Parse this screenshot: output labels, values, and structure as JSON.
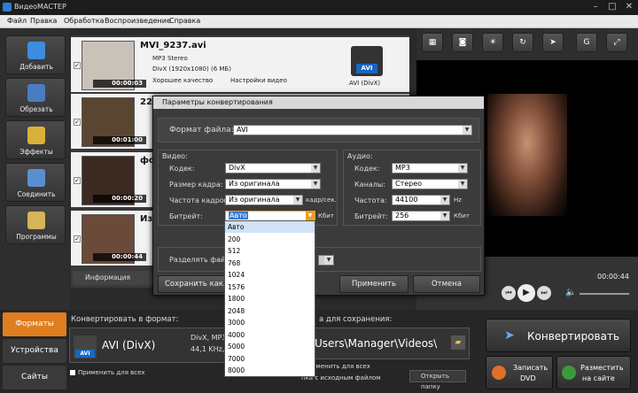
{
  "window": {
    "title": "ВидеоМАСТЕР"
  },
  "menu": [
    "Файл",
    "Правка",
    "Обработка",
    "Воспроизведение",
    "Справка"
  ],
  "sidebar": [
    "Добавить",
    "Обрезать",
    "Эффекты",
    "Соединить",
    "Программы"
  ],
  "files": [
    {
      "name": "MVI_9237.avi",
      "audio": "MP3 Stereo",
      "video": "DivX (1920x1080) (6 МБ)",
      "quality": "Хорошее качество",
      "settings": "Настройки видео",
      "duration": "00:00:03",
      "format": "AVI",
      "format_full": "AVI (DivX)"
    },
    {
      "name": "222",
      "duration": "00:01:00"
    },
    {
      "name": "фот",
      "duration": "00:00:20"
    },
    {
      "name": "Изб",
      "duration": "00:00:44"
    }
  ],
  "filelist_footer": {
    "info_tab": "Информация"
  },
  "dialog": {
    "title": "Параметры конвертирования",
    "format_label": "Формат файла:",
    "format_value": "AVI",
    "video_section": "Видео:",
    "audio_section": "Аудио:",
    "codec_label": "Кодек:",
    "codec_value": "DivX",
    "frame_size_label": "Размер кадра:",
    "frame_size_value": "Из оригинала",
    "fps_label": "Частота кадров:",
    "fps_value": "Из оригинала",
    "fps_unit": "кадр/сек.",
    "bitrate_label": "Битрейт:",
    "bitrate_value": "Авто",
    "bitrate_unit": "Кбит",
    "a_codec_label": "Кодек:",
    "a_codec_value": "MP3",
    "channels_label": "Каналы:",
    "channels_value": "Стерео",
    "freq_label": "Частота:",
    "freq_value": "44100",
    "freq_unit": "Hz",
    "a_bitrate_label": "Битрейт:",
    "a_bitrate_value": "256",
    "a_bitrate_unit": "Кбит",
    "split_label": "Разделять файл:",
    "save_button": "Сохранить как...",
    "apply_button": "Применить",
    "cancel_button": "Отмена"
  },
  "bitrate_options": [
    "Авто",
    "200",
    "512",
    "768",
    "1024",
    "1576",
    "1800",
    "2048",
    "3000",
    "4000",
    "5000",
    "7000",
    "8000"
  ],
  "player": {
    "time": "00:00:44"
  },
  "bottom": {
    "tabs": [
      "Форматы",
      "Устройства",
      "Сайты"
    ],
    "convert_to_label": "Конвертировать в формат:",
    "format_name": "AVI (DivX)",
    "format_badge": "AVI",
    "format_detail_1": "DivX, MP3",
    "format_detail_2": "44,1 KHz,",
    "apply_all": "Применить для всех",
    "save_folder_label": "а для сохранения:",
    "save_path": "Users\\Manager\\Videos\\",
    "apply_all_2": "именить для всех",
    "source_folder": "пка с исходным файлом",
    "open_folder": "Открыть папку",
    "convert_button": "Конвертировать",
    "dvd_button_1": "Записать",
    "dvd_button_2": "DVD",
    "site_button_1": "Разместить",
    "site_button_2": "на сайте"
  }
}
